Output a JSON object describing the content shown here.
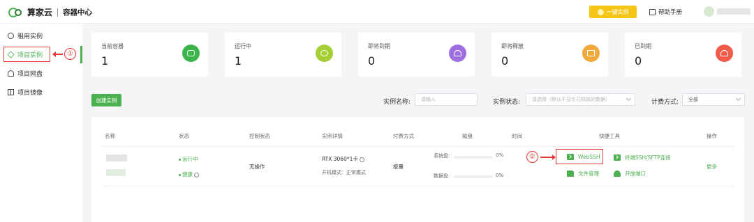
{
  "header": {
    "brand": "算家云",
    "section": "容器中心",
    "quick_button": "一键实例",
    "help": "帮助手册"
  },
  "sidebar": {
    "items": [
      {
        "label": "租用实例",
        "icon": "gauge-icon"
      },
      {
        "label": "项目实例",
        "icon": "cube-icon",
        "active": true
      },
      {
        "label": "项目网盘",
        "icon": "cloud-drive-icon"
      },
      {
        "label": "项目镜像",
        "icon": "image-grid-icon"
      }
    ],
    "annotation": "①"
  },
  "stats": [
    {
      "label": "当前容器",
      "value": "1",
      "color": "#3bb54a",
      "icon": "container-icon"
    },
    {
      "label": "运行中",
      "value": "1",
      "color": "#a5cf34",
      "icon": "running-icon"
    },
    {
      "label": "即将到期",
      "value": "0",
      "color": "#9c6ee0",
      "icon": "bell-icon"
    },
    {
      "label": "即将释放",
      "value": "0",
      "color": "#f2a93b",
      "icon": "release-icon"
    },
    {
      "label": "已到期",
      "value": "0",
      "color": "#f05b4a",
      "icon": "alarm-icon"
    }
  ],
  "toolbar": {
    "create_button": "创建实例",
    "name_label": "实例名称:",
    "name_placeholder": "请输入",
    "status_label": "实例状态:",
    "status_placeholder": "请选择（默认不显示已释放的数据）",
    "billing_label": "计费方式:",
    "billing_value": "全部"
  },
  "table": {
    "headers": [
      "名称",
      "状态",
      "控制状态",
      "实例详情",
      "付费方式",
      "磁盘",
      "时间",
      "快捷工具",
      "操作"
    ],
    "row": {
      "status_running": "运行中",
      "status_health": "健康",
      "control_status": "无操作",
      "gpu": "RTX 3060*1卡",
      "boot_mode": "开机模式：正常模式",
      "billing": "按量",
      "system_disk_label": "系统盘:",
      "system_disk_pct": "0%",
      "system_disk_value": 0,
      "data_disk_label": "数据盘:",
      "data_disk_pct": "0%",
      "data_disk_value": 0,
      "tool_webssh": "WebSSH",
      "tool_ssh_sftp": "终端SSH/SFTP连接",
      "tool_files": "文件管理",
      "tool_ports": "开放端口",
      "more": "更多"
    },
    "annotation": "②"
  }
}
